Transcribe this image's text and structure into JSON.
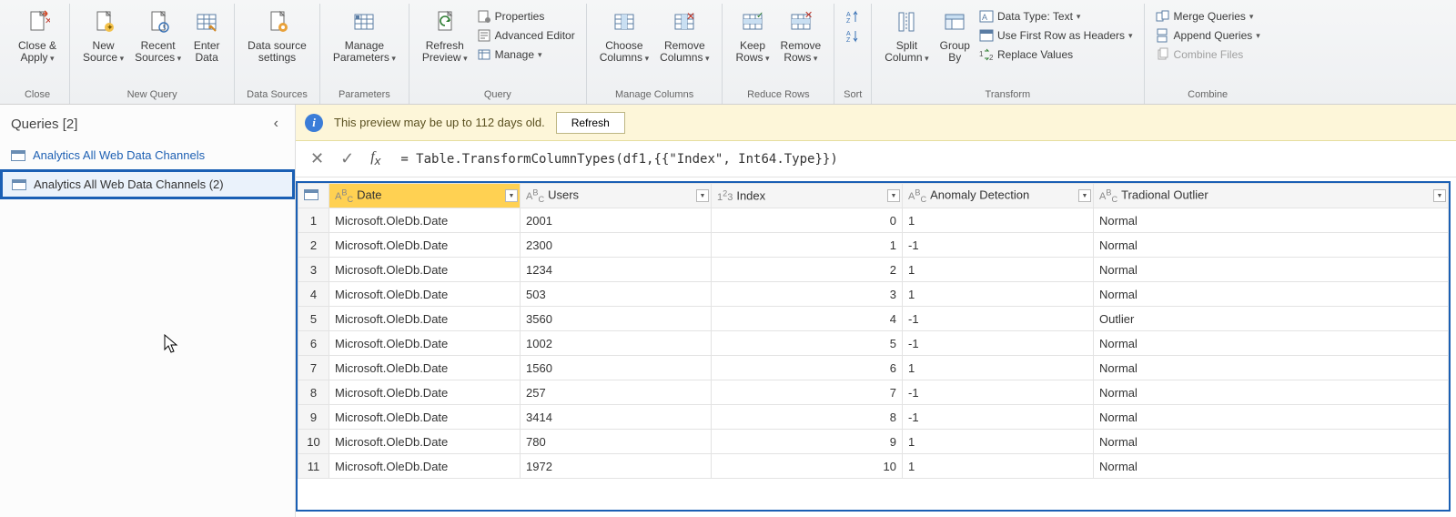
{
  "ribbon": {
    "groups": [
      {
        "label": "Close",
        "buttons_big": [
          {
            "key": "close_apply",
            "label": "Close &\nApply",
            "dd": true
          }
        ]
      },
      {
        "label": "New Query",
        "buttons_big": [
          {
            "key": "new_source",
            "label": "New\nSource",
            "dd": true
          },
          {
            "key": "recent_sources",
            "label": "Recent\nSources",
            "dd": true
          },
          {
            "key": "enter_data",
            "label": "Enter\nData"
          }
        ]
      },
      {
        "label": "Data Sources",
        "buttons_big": [
          {
            "key": "ds_settings",
            "label": "Data source\nsettings"
          }
        ]
      },
      {
        "label": "Parameters",
        "buttons_big": [
          {
            "key": "manage_params",
            "label": "Manage\nParameters",
            "dd": true
          }
        ]
      },
      {
        "label": "Query",
        "buttons_big": [
          {
            "key": "refresh_preview",
            "label": "Refresh\nPreview",
            "dd": true
          }
        ],
        "mini": [
          {
            "key": "properties",
            "label": "Properties"
          },
          {
            "key": "adv_editor",
            "label": "Advanced Editor"
          },
          {
            "key": "manage",
            "label": "Manage",
            "dd": true
          }
        ]
      },
      {
        "label": "Manage Columns",
        "buttons_big": [
          {
            "key": "choose_cols",
            "label": "Choose\nColumns",
            "dd": true
          },
          {
            "key": "remove_cols",
            "label": "Remove\nColumns",
            "dd": true
          }
        ]
      },
      {
        "label": "Reduce Rows",
        "buttons_big": [
          {
            "key": "keep_rows",
            "label": "Keep\nRows",
            "dd": true
          },
          {
            "key": "remove_rows",
            "label": "Remove\nRows",
            "dd": true
          }
        ]
      },
      {
        "label": "Sort",
        "stack_icon": true
      },
      {
        "label": "Transform",
        "buttons_big": [
          {
            "key": "split_col",
            "label": "Split\nColumn",
            "dd": true
          },
          {
            "key": "group_by",
            "label": "Group\nBy"
          }
        ],
        "mini": [
          {
            "key": "data_type",
            "label": "Data Type: Text",
            "dd": true
          },
          {
            "key": "first_row_headers",
            "label": "Use First Row as Headers",
            "dd": true
          },
          {
            "key": "replace_values",
            "label": "Replace Values"
          }
        ]
      },
      {
        "label": "Combine",
        "mini": [
          {
            "key": "merge_q",
            "label": "Merge Queries",
            "dd": true
          },
          {
            "key": "append_q",
            "label": "Append Queries",
            "dd": true
          },
          {
            "key": "combine_files",
            "label": "Combine Files",
            "disabled": true
          }
        ]
      }
    ]
  },
  "side": {
    "title": "Queries [2]",
    "items": [
      {
        "label": "Analytics All Web Data Channels",
        "selected": false
      },
      {
        "label": "Analytics All Web Data Channels (2)",
        "selected": true
      }
    ]
  },
  "notice": {
    "text": "This preview may be up to 112 days old.",
    "button": "Refresh"
  },
  "formula": "= Table.TransformColumnTypes(df1,{{\"Index\", Int64.Type}})",
  "table": {
    "columns": [
      {
        "name": "Date",
        "type": "ABC",
        "selected": true
      },
      {
        "name": "Users",
        "type": "ABC"
      },
      {
        "name": "Index",
        "type": "123",
        "align": "right"
      },
      {
        "name": "Anomaly Detection",
        "type": "ABC"
      },
      {
        "name": "Tradional Outlier",
        "type": "ABC"
      }
    ],
    "rows": [
      [
        "Microsoft.OleDb.Date",
        "2001",
        "0",
        "1",
        "Normal"
      ],
      [
        "Microsoft.OleDb.Date",
        "2300",
        "1",
        "-1",
        "Normal"
      ],
      [
        "Microsoft.OleDb.Date",
        "1234",
        "2",
        "1",
        "Normal"
      ],
      [
        "Microsoft.OleDb.Date",
        "503",
        "3",
        "1",
        "Normal"
      ],
      [
        "Microsoft.OleDb.Date",
        "3560",
        "4",
        "-1",
        "Outlier"
      ],
      [
        "Microsoft.OleDb.Date",
        "1002",
        "5",
        "-1",
        "Normal"
      ],
      [
        "Microsoft.OleDb.Date",
        "1560",
        "6",
        "1",
        "Normal"
      ],
      [
        "Microsoft.OleDb.Date",
        "257",
        "7",
        "-1",
        "Normal"
      ],
      [
        "Microsoft.OleDb.Date",
        "3414",
        "8",
        "-1",
        "Normal"
      ],
      [
        "Microsoft.OleDb.Date",
        "780",
        "9",
        "1",
        "Normal"
      ],
      [
        "Microsoft.OleDb.Date",
        "1972",
        "10",
        "1",
        "Normal"
      ]
    ]
  }
}
